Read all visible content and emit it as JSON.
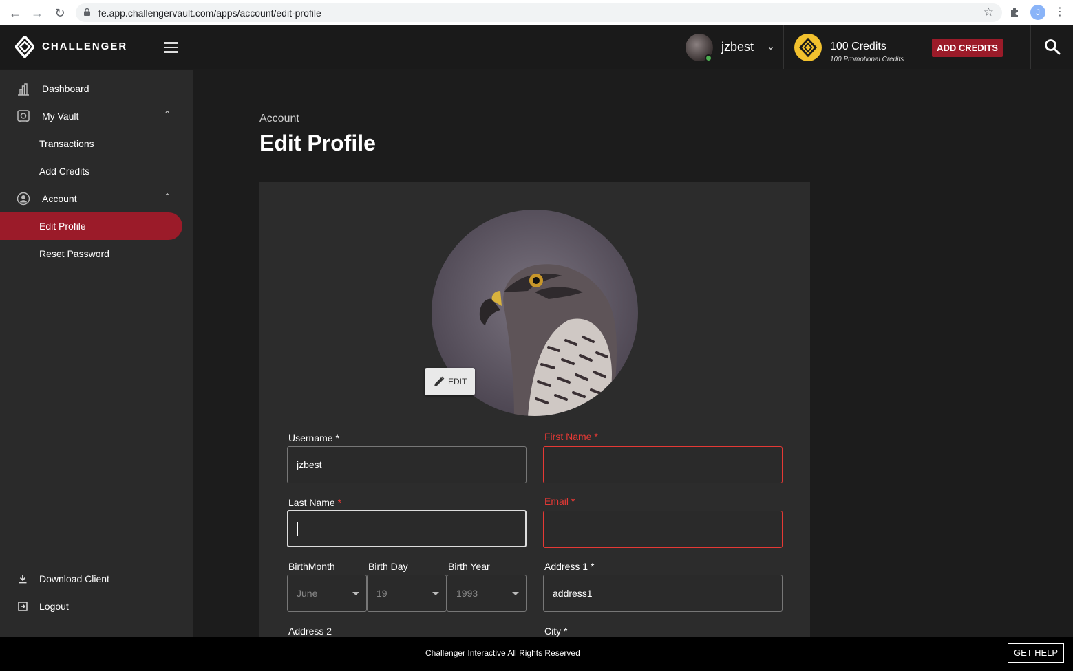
{
  "browser": {
    "url": "fe.app.challengervault.com/apps/account/edit-profile",
    "profile_initial": "J"
  },
  "header": {
    "brand": "CHALLENGER",
    "username": "jzbest",
    "credits": "100 Credits",
    "promo_credits": "100 Promotional Credits",
    "add_credits_label": "ADD CREDITS",
    "accent_color": "#9b1b29",
    "coin_color": "#f2c12e"
  },
  "sidebar": {
    "items": [
      {
        "label": "Dashboard",
        "icon": "dashboard-icon"
      },
      {
        "label": "My Vault",
        "icon": "vault-icon",
        "expanded": true
      },
      {
        "label": "Transactions"
      },
      {
        "label": "Add Credits"
      },
      {
        "label": "Account",
        "icon": "account-circle-icon",
        "expanded": true
      },
      {
        "label": "Edit Profile",
        "active": true
      },
      {
        "label": "Reset Password"
      }
    ],
    "bottom": [
      {
        "label": "Download Client",
        "icon": "download-icon"
      },
      {
        "label": "Logout",
        "icon": "logout-icon"
      }
    ]
  },
  "main": {
    "breadcrumb": "Account",
    "title": "Edit Profile",
    "edit_label": "EDIT",
    "form": {
      "username": {
        "label": "Username",
        "required": "*",
        "value": "jzbest"
      },
      "first_name": {
        "label": "First Name",
        "required": "*",
        "value": ""
      },
      "last_name": {
        "label": "Last Name",
        "required": "*",
        "value": ""
      },
      "email": {
        "label": "Email",
        "required": "*",
        "value": ""
      },
      "birth_month": {
        "label": "BirthMonth",
        "value": "June"
      },
      "birth_day": {
        "label": "Birth Day",
        "value": "19"
      },
      "birth_year": {
        "label": "Birth Year",
        "value": "1993"
      },
      "address1": {
        "label": "Address 1",
        "required": "*",
        "value": "address1"
      },
      "address2": {
        "label": "Address 2"
      },
      "city": {
        "label": "City",
        "required": "*"
      }
    }
  },
  "footer": {
    "copyright": "Challenger Interactive All Rights Reserved",
    "help_label": "GET HELP"
  }
}
